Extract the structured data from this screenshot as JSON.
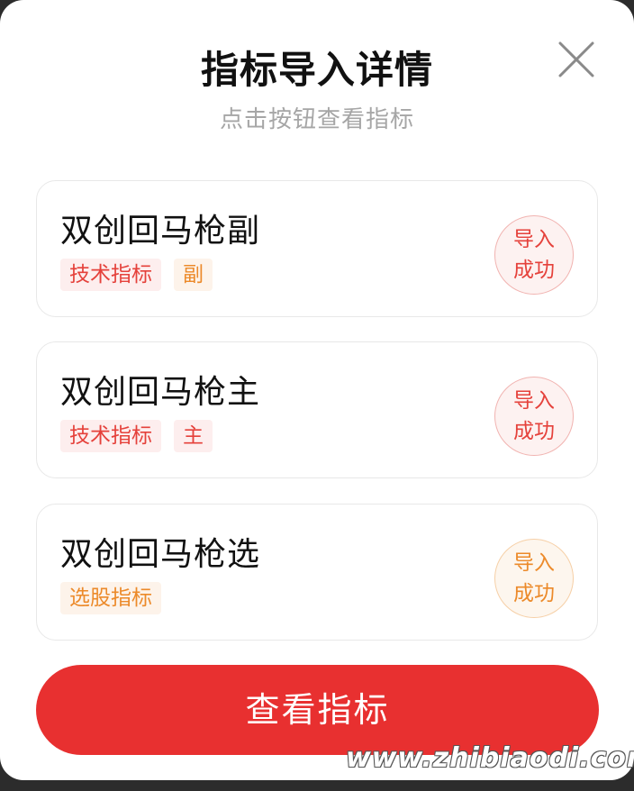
{
  "dialog": {
    "title": "指标导入详情",
    "subtitle": "点击按钮查看指标",
    "close_icon": "close-icon"
  },
  "cards": [
    {
      "name": "双创回马枪副",
      "tags": [
        {
          "text": "技术指标",
          "color": "red"
        },
        {
          "text": "副",
          "color": "orange"
        }
      ],
      "status_line1": "导入",
      "status_line2": "成功",
      "status_color": "red"
    },
    {
      "name": "双创回马枪主",
      "tags": [
        {
          "text": "技术指标",
          "color": "red"
        },
        {
          "text": "主",
          "color": "red"
        }
      ],
      "status_line1": "导入",
      "status_line2": "成功",
      "status_color": "red"
    },
    {
      "name": "双创回马枪选",
      "tags": [
        {
          "text": "选股指标",
          "color": "orange"
        }
      ],
      "status_line1": "导入",
      "status_line2": "成功",
      "status_color": "orange"
    }
  ],
  "actions": {
    "view_button": "查看指标"
  },
  "watermark": "www.zhibiaodi.com",
  "colors": {
    "accent_red": "#e83030",
    "tag_red": "#e5413b",
    "tag_orange": "#ec8a2a"
  }
}
